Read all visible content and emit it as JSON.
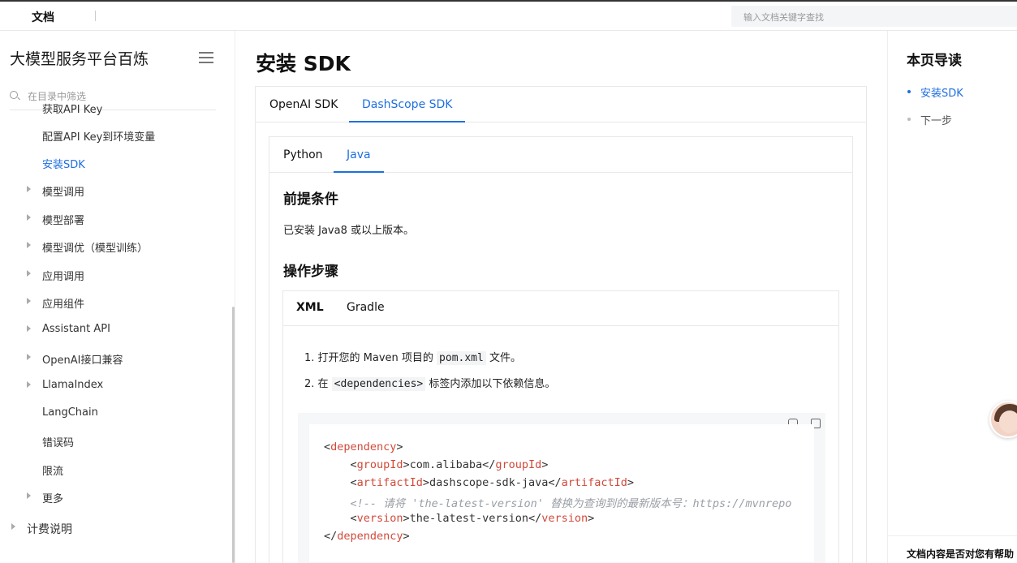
{
  "topbar": {
    "brand": "文档",
    "search_placeholder": "输入文档关键字查找"
  },
  "sidebar": {
    "title": "大模型服务平台百炼",
    "filter_placeholder": "在目录中筛选",
    "items": [
      {
        "label": "获取API Key",
        "arrow": false,
        "active": false
      },
      {
        "label": "配置API Key到环境变量",
        "arrow": false,
        "active": false
      },
      {
        "label": "安装SDK",
        "arrow": false,
        "active": true
      },
      {
        "label": "模型调用",
        "arrow": true,
        "active": false
      },
      {
        "label": "模型部署",
        "arrow": true,
        "active": false
      },
      {
        "label": "模型调优（模型训练）",
        "arrow": true,
        "active": false
      },
      {
        "label": "应用调用",
        "arrow": true,
        "active": false
      },
      {
        "label": "应用组件",
        "arrow": true,
        "active": false
      },
      {
        "label": "Assistant API",
        "arrow": true,
        "active": false
      },
      {
        "label": "OpenAI接口兼容",
        "arrow": true,
        "active": false
      },
      {
        "label": "LlamaIndex",
        "arrow": true,
        "active": false
      },
      {
        "label": "LangChain",
        "arrow": false,
        "active": false
      },
      {
        "label": "错误码",
        "arrow": false,
        "active": false
      },
      {
        "label": "限流",
        "arrow": false,
        "active": false
      },
      {
        "label": "更多",
        "arrow": true,
        "active": false
      },
      {
        "label": "计费说明",
        "arrow": true,
        "active": false
      }
    ]
  },
  "main": {
    "title": "安装 SDK",
    "sdk_tabs": [
      "OpenAI SDK",
      "DashScope SDK"
    ],
    "lang_tabs": [
      "Python",
      "Java"
    ],
    "prereq_heading": "前提条件",
    "prereq_text": "已安装 Java8 或以上版本。",
    "steps_heading": "操作步骤",
    "build_tabs": [
      "XML",
      "Gradle"
    ],
    "step1": {
      "prefix": "1. 打开您的 Maven 项目的 ",
      "code": "pom.xml",
      "suffix": " 文件。"
    },
    "step2": {
      "prefix": "2. 在 ",
      "code": "<dependencies>",
      "suffix": " 标签内添加以下依赖信息。"
    },
    "code": {
      "l1_open": "<",
      "l1_tag": "dependency",
      "l1_close": ">",
      "l2_a": "    <",
      "l2_tag": "groupId",
      "l2_b": ">com.alibaba</",
      "l2_tag2": "groupId",
      "l2_c": ">",
      "l3_a": "    <",
      "l3_tag": "artifactId",
      "l3_b": ">dashscope-sdk-java</",
      "l3_tag2": "artifactId",
      "l3_c": ">",
      "l4_comment": "    <!-- 请将 'the-latest-version' 替换为查询到的最新版本号：https://mvnrepo",
      "l5_a": "    <",
      "l5_tag": "version",
      "l5_b": ">the-latest-version</",
      "l5_tag2": "version",
      "l5_c": ">",
      "l6_a": "</",
      "l6_tag": "dependency",
      "l6_c": ">"
    }
  },
  "toc": {
    "title": "本页导读",
    "items": [
      {
        "label": "安装SDK",
        "active": true
      },
      {
        "label": "下一步",
        "active": false
      }
    ],
    "feedback": "文档内容是否对您有帮助"
  },
  "colors": {
    "accent": "#1f6fe0",
    "xml_tag": "#d14a3b",
    "comment": "#9aa0a6"
  }
}
